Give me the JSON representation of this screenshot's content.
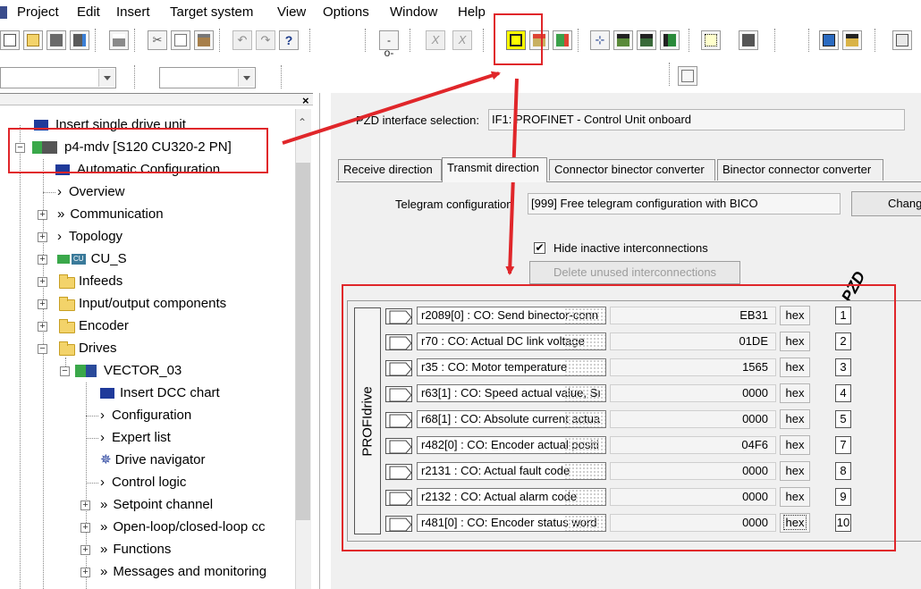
{
  "menu": [
    "Project",
    "Edit",
    "Insert",
    "Target system",
    "View",
    "Options",
    "Window",
    "Help"
  ],
  "tree": {
    "items": [
      {
        "label": "Insert single drive unit"
      },
      {
        "label": "p4-mdv [S120 CU320-2 PN]"
      },
      {
        "label": "Automatic Configuration"
      },
      {
        "label": "Overview"
      },
      {
        "label": "Communication"
      },
      {
        "label": "Topology"
      },
      {
        "label": "CU_S"
      },
      {
        "label": "Infeeds"
      },
      {
        "label": "Input/output components"
      },
      {
        "label": "Encoder"
      },
      {
        "label": "Drives"
      },
      {
        "label": "VECTOR_03"
      },
      {
        "label": "Insert DCC chart"
      },
      {
        "label": "Configuration"
      },
      {
        "label": "Expert list"
      },
      {
        "label": "Drive navigator"
      },
      {
        "label": "Control logic"
      },
      {
        "label": "Setpoint channel"
      },
      {
        "label": "Open-loop/closed-loop cc"
      },
      {
        "label": "Functions"
      },
      {
        "label": "Messages and monitoring"
      }
    ],
    "cu_badge": "CU"
  },
  "pzd": {
    "interface_label": "PZD interface selection:",
    "interface_value": "IF1:  PROFINET - Control Unit onboard",
    "tabs": [
      "Receive direction",
      "Transmit direction",
      "Connector binector converter",
      "Binector connector converter"
    ],
    "telegram_label": "Telegram configuration",
    "telegram_value": "[999] Free telegram configuration with BICO",
    "change_button": "Chang",
    "hide_inactive_label": "Hide inactive interconnections",
    "hide_inactive_checked": "✔",
    "delete_unused_button": "Delete unused interconnections",
    "profidrive_label": "PROFIdrive",
    "pzd_label": "PZD",
    "rows": [
      {
        "param": "r2089[0] : CO: Send binector-conn",
        "value": "EB31",
        "fmt": "hex",
        "num": "1"
      },
      {
        "param": "r70 : CO: Actual DC link voltage",
        "value": "01DE",
        "fmt": "hex",
        "num": "2"
      },
      {
        "param": "r35 : CO: Motor temperature",
        "value": "1565",
        "fmt": "hex",
        "num": "3"
      },
      {
        "param": "r63[1] : CO: Speed actual value, Sı",
        "value": "0000",
        "fmt": "hex",
        "num": "4"
      },
      {
        "param": "r68[1] : CO: Absolute current actua",
        "value": "0000",
        "fmt": "hex",
        "num": "5"
      },
      {
        "param": "r482[0] : CO: Encoder actual positi",
        "value": "04F6",
        "fmt": "hex",
        "num": "7"
      },
      {
        "param": "r2131 : CO: Actual fault code",
        "value": "0000",
        "fmt": "hex",
        "num": "8"
      },
      {
        "param": "r2132 : CO: Actual alarm code",
        "value": "0000",
        "fmt": "hex",
        "num": "9"
      },
      {
        "param": "r481[0] : CO: Encoder status word",
        "value": "0000",
        "fmt": "hex",
        "num": "10"
      }
    ]
  },
  "colors": {
    "annotation_red": "#e0262a",
    "highlight_yellow": "#ffff00"
  }
}
